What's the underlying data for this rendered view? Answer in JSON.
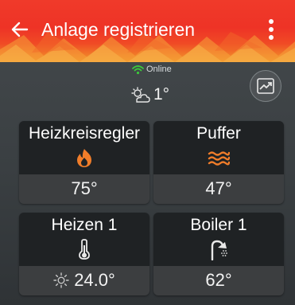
{
  "header": {
    "title": "Anlage registrieren",
    "back_icon": "arrow-left-icon",
    "menu_icon": "more-vertical-icon",
    "colors": {
      "primary": "#ee3326",
      "accent": "#f29a2a"
    }
  },
  "status": {
    "connection_icon": "wifi-icon",
    "connection_text": "Online",
    "weather_icon": "partly-cloudy-icon",
    "outdoor_temp": "1°"
  },
  "chart_button": {
    "icon": "trend-chart-icon"
  },
  "tiles": [
    {
      "name": "Heizkreisregler",
      "icon": "flame-icon",
      "value": "75°"
    },
    {
      "name": "Puffer",
      "icon": "waves-icon",
      "value": "47°"
    },
    {
      "name": "Heizen 1",
      "icon": "thermometer-icon",
      "value_icon": "sun-gear-icon",
      "value": "24.0°"
    },
    {
      "name": "Boiler 1",
      "icon": "shower-icon",
      "value": "62°"
    }
  ],
  "colors": {
    "tile_bg": "#1f2224",
    "tile_value_bg": "#3c3e40",
    "icon_orange": "#f07d2a",
    "online_green": "#3cc83c"
  }
}
